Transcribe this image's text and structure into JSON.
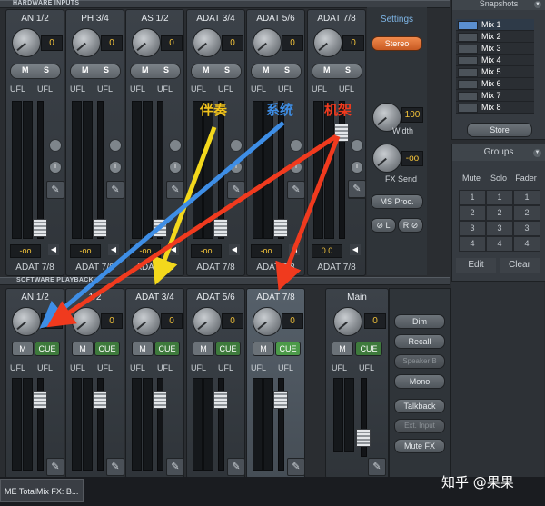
{
  "hardware_inputs": {
    "label": "HARDWARE INPUTS",
    "channels": [
      {
        "name": "AN  1/2",
        "value": "0",
        "route": "ADAT 7/8",
        "out": "-oo"
      },
      {
        "name": "PH  3/4",
        "value": "0",
        "route": "ADAT 7/8",
        "out": "-oo"
      },
      {
        "name": "AS  1/2",
        "value": "0",
        "route": "ADAT 7/8",
        "out": "-oo"
      },
      {
        "name": "ADAT  3/4",
        "value": "0",
        "route": "ADAT 7/8",
        "out": "-oo"
      },
      {
        "name": "ADAT  5/6",
        "value": "0",
        "route": "ADAT 7/8",
        "out": "-oo"
      },
      {
        "name": "ADAT  7/8",
        "value": "0",
        "route": "ADAT 7/8",
        "out": "0.0"
      }
    ],
    "m_label": "M",
    "s_label": "S",
    "ufl": "UFL"
  },
  "software_playback": {
    "label": "SOFTWARE PLAYBACK",
    "channels": [
      {
        "name": "AN  1/2",
        "value": "0"
      },
      {
        "name": "1/2",
        "value": "0"
      },
      {
        "name": "ADAT  3/4",
        "value": "0"
      },
      {
        "name": "ADAT  5/6",
        "value": "0"
      },
      {
        "name": "ADAT  7/8",
        "value": "0"
      }
    ],
    "m_label": "M",
    "cue_label": "CUE",
    "ufl": "UFL"
  },
  "main": {
    "name": "Main",
    "value": "0",
    "m_label": "M",
    "cue_label": "CUE",
    "ufl": "UFL"
  },
  "settings_panel": {
    "settings_label": "Settings",
    "stereo_label": "Stereo",
    "width_value": "100",
    "width_label": "Width",
    "fx_value": "-oo",
    "fx_label": "FX Send",
    "ms_proc_label": "MS Proc.",
    "phase_l_label": "⊘ L",
    "phase_r_label": "R ⊘"
  },
  "output_buttons": {
    "dim": "Dim",
    "recall": "Recall",
    "speaker_b": "Speaker B",
    "mono": "Mono",
    "talkback": "Talkback",
    "ext_input": "Ext. Input",
    "mute_fx": "Mute FX"
  },
  "snapshots": {
    "title": "Snapshots",
    "items": [
      "Mix 1",
      "Mix 2",
      "Mix 3",
      "Mix 4",
      "Mix 5",
      "Mix 6",
      "Mix 7",
      "Mix 8"
    ],
    "store_label": "Store"
  },
  "groups": {
    "title": "Groups",
    "columns": [
      "Mute",
      "Solo",
      "Fader"
    ],
    "rows": [
      [
        "1",
        "1",
        "1"
      ],
      [
        "2",
        "2",
        "2"
      ],
      [
        "3",
        "3",
        "3"
      ],
      [
        "4",
        "4",
        "4"
      ]
    ],
    "edit_label": "Edit",
    "clear_label": "Clear"
  },
  "annotations": {
    "accompaniment": "伴奏",
    "system": "系统",
    "rack": "机架"
  },
  "annotation_colors": {
    "yellow": "#f3d81c",
    "blue": "#3e8ee6",
    "red": "#f03a1e"
  },
  "taskbar": {
    "title": "ME TotalMix FX: B..."
  },
  "watermark": "知乎 @果果"
}
